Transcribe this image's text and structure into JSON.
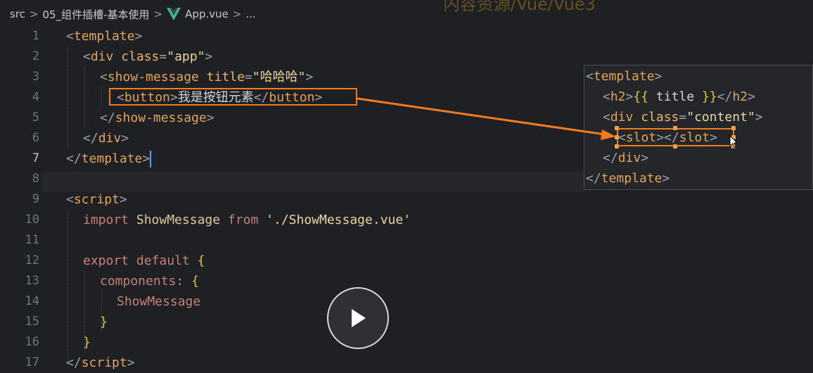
{
  "breadcrumb": {
    "items": [
      "src",
      "05_组件插槽-基本使用",
      "App.vue",
      "..."
    ],
    "separator": ">"
  },
  "overlay_title": "内容资源/Vue/Vue3",
  "editor": {
    "active_line": 7,
    "lines": [
      {
        "n": "1"
      },
      {
        "n": "2"
      },
      {
        "n": "3"
      },
      {
        "n": "4"
      },
      {
        "n": "5"
      },
      {
        "n": "6"
      },
      {
        "n": "7"
      },
      {
        "n": "8"
      },
      {
        "n": "9"
      },
      {
        "n": "10"
      },
      {
        "n": "11"
      },
      {
        "n": "12"
      },
      {
        "n": "13"
      },
      {
        "n": "14"
      },
      {
        "n": "15"
      },
      {
        "n": "16"
      },
      {
        "n": "17"
      }
    ],
    "code": {
      "template_open": "template",
      "div": "div",
      "class_attr": "class",
      "class_value": "\"app\"",
      "show_message": "show-message",
      "title_attr": "title",
      "title_value": "\"哈哈哈\"",
      "button": "button",
      "button_text": "我是按钮元素",
      "script": "script",
      "import_kw": "import",
      "import_name": "ShowMessage",
      "from_kw": "from",
      "import_path": "'./ShowMessage.vue'",
      "export_kw": "export",
      "default_kw": "default",
      "components_key": "components",
      "components_item": "ShowMessage"
    }
  },
  "popup": {
    "template": "template",
    "h2": "h2",
    "mustache_open": "{{",
    "title_expr": "title",
    "mustache_close": "}}",
    "div": "div",
    "class_attr": "class",
    "class_value": "\"content\"",
    "slot": "slot"
  },
  "colors": {
    "highlight": "#f07c1e",
    "vue_green": "#41b883"
  }
}
